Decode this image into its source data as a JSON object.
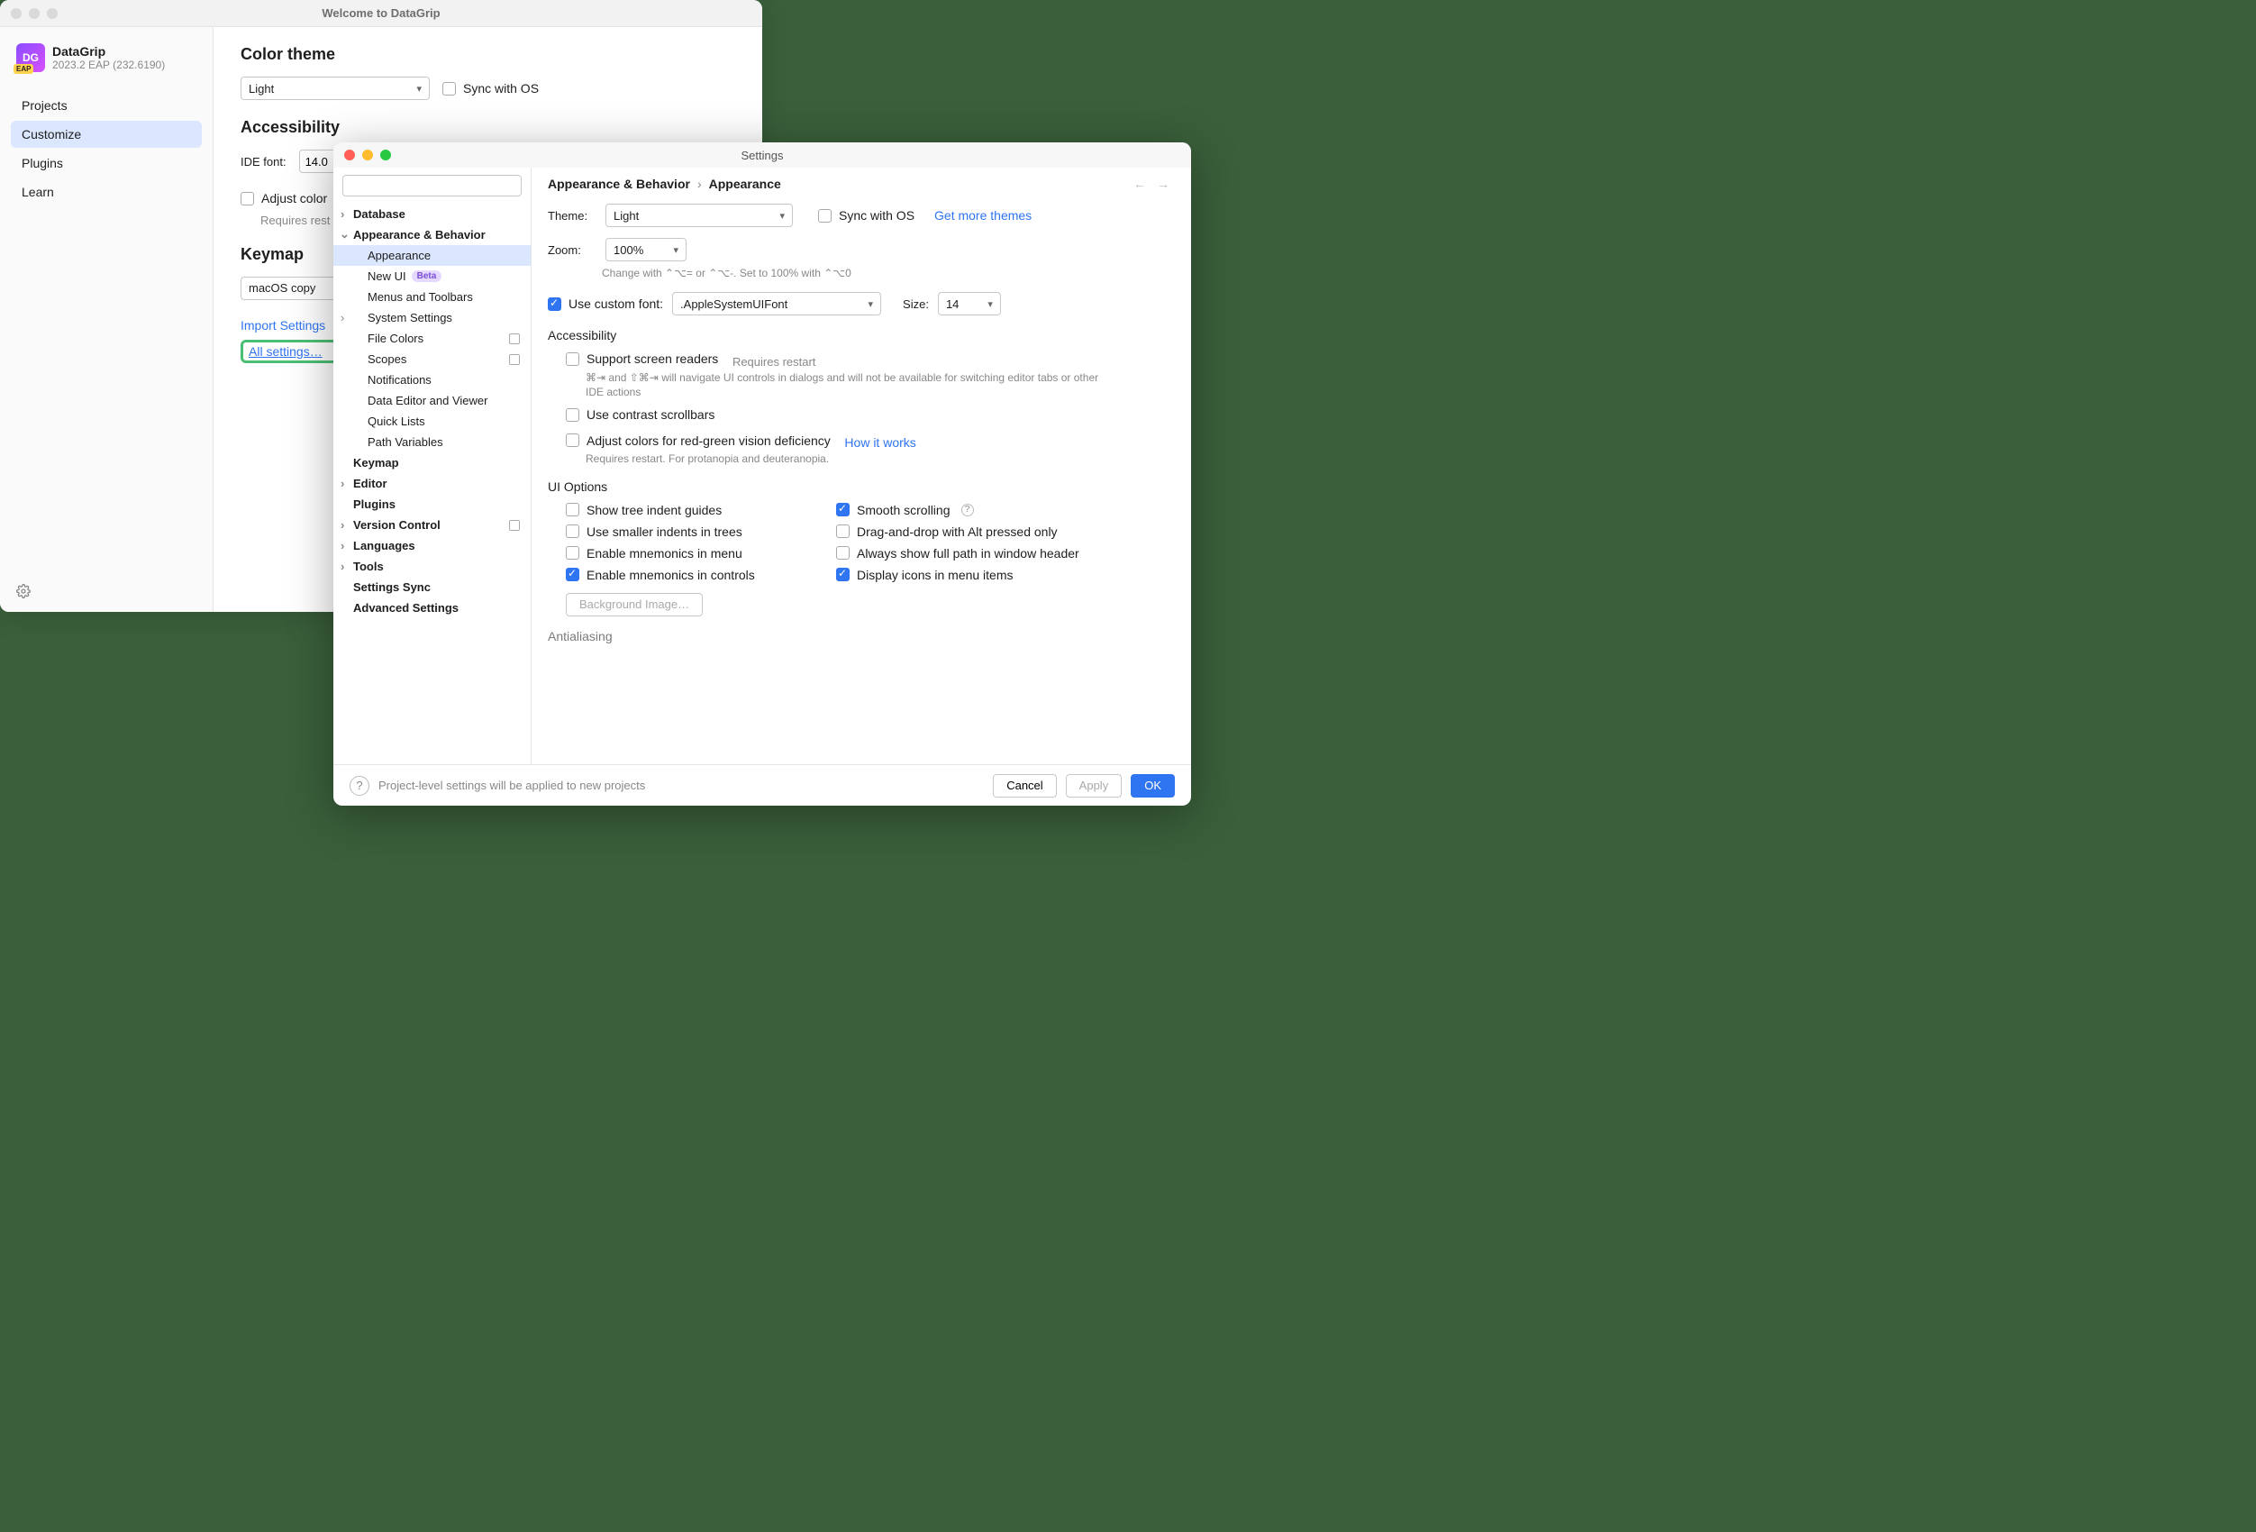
{
  "welcome": {
    "title": "Welcome to DataGrip",
    "app_name": "DataGrip",
    "app_version": "2023.2 EAP (232.6190)",
    "nav": [
      "Projects",
      "Customize",
      "Plugins",
      "Learn"
    ],
    "nav_selected": 1,
    "color_theme": {
      "heading": "Color theme",
      "theme_value": "Light",
      "sync_label": "Sync with OS"
    },
    "accessibility": {
      "heading": "Accessibility",
      "ide_font_label": "IDE font:",
      "ide_font_value": "14.0",
      "adjust_label": "Adjust color",
      "restart_hint": "Requires rest"
    },
    "keymap": {
      "heading": "Keymap",
      "value": "macOS copy"
    },
    "links": {
      "import": "Import Settings",
      "all": "All settings…"
    }
  },
  "settings": {
    "title": "Settings",
    "search_placeholder": "",
    "tree": {
      "database": "Database",
      "appearance_behavior": "Appearance & Behavior",
      "appearance": "Appearance",
      "new_ui": "New UI",
      "new_ui_badge": "Beta",
      "menus_toolbars": "Menus and Toolbars",
      "system_settings": "System Settings",
      "file_colors": "File Colors",
      "scopes": "Scopes",
      "notifications": "Notifications",
      "data_editor": "Data Editor and Viewer",
      "quick_lists": "Quick Lists",
      "path_variables": "Path Variables",
      "keymap": "Keymap",
      "editor": "Editor",
      "plugins": "Plugins",
      "version_control": "Version Control",
      "languages": "Languages",
      "tools": "Tools",
      "settings_sync": "Settings Sync",
      "advanced": "Advanced Settings"
    },
    "breadcrumb": {
      "a": "Appearance & Behavior",
      "b": "Appearance"
    },
    "theme": {
      "label": "Theme:",
      "value": "Light",
      "sync_label": "Sync with OS",
      "more_link": "Get more themes"
    },
    "zoom": {
      "label": "Zoom:",
      "value": "100%",
      "hint": "Change with ⌃⌥= or ⌃⌥-. Set to 100% with ⌃⌥0"
    },
    "custom_font": {
      "label": "Use custom font:",
      "font_value": ".AppleSystemUIFont",
      "size_label": "Size:",
      "size_value": "14"
    },
    "accessibility": {
      "heading": "Accessibility",
      "screen_readers": "Support screen readers",
      "screen_readers_hint": "Requires restart",
      "screen_readers_desc": "⌘⇥ and ⇧⌘⇥ will navigate UI controls in dialogs and will not be available for switching editor tabs or other IDE actions",
      "contrast": "Use contrast scrollbars",
      "adjust_colors": "Adjust colors for red-green vision deficiency",
      "how_it_works": "How it works",
      "adjust_desc": "Requires restart. For protanopia and deuteranopia."
    },
    "ui_options": {
      "heading": "UI Options",
      "tree_guides": "Show tree indent guides",
      "smooth": "Smooth scrolling",
      "smaller_indents": "Use smaller indents in trees",
      "dnd_alt": "Drag-and-drop with Alt pressed only",
      "mnemonics_menu": "Enable mnemonics in menu",
      "full_path": "Always show full path in window header",
      "mnemonics_controls": "Enable mnemonics in controls",
      "display_icons": "Display icons in menu items",
      "bg_image": "Background Image…"
    },
    "antialiasing_heading": "Antialiasing",
    "footer": {
      "hint": "Project-level settings will be applied to new projects",
      "cancel": "Cancel",
      "apply": "Apply",
      "ok": "OK"
    }
  }
}
